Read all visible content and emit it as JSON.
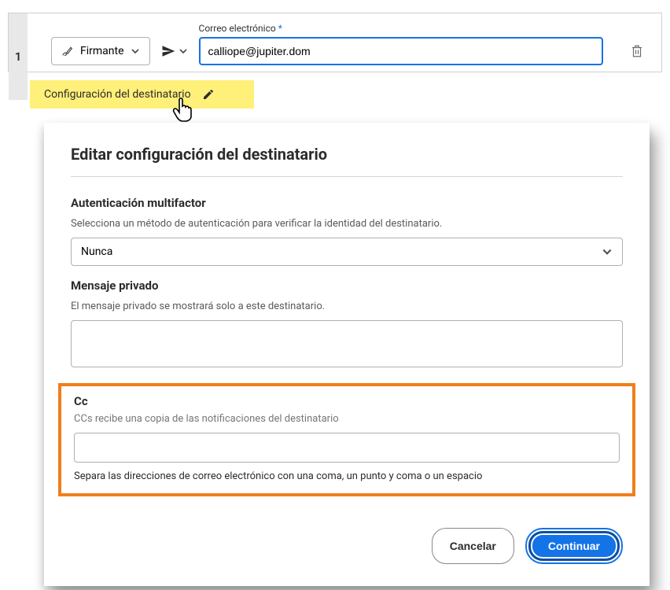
{
  "recipient": {
    "number": "1",
    "role_label": "Firmante",
    "email_label": "Correo electrónico",
    "email_value": "calliope@jupiter.dom",
    "config_label": "Configuración del destinatario"
  },
  "modal": {
    "title": "Editar configuración del destinatario",
    "auth": {
      "heading": "Autenticación multifactor",
      "description": "Selecciona un método de autenticación para verificar la identidad del destinatario.",
      "selected": "Nunca"
    },
    "private_message": {
      "heading": "Mensaje privado",
      "description": "El mensaje privado se mostrará solo a este destinatario.",
      "value": ""
    },
    "cc": {
      "heading": "Cc",
      "description": "CCs recibe una copia de las notificaciones del destinatario",
      "value": "",
      "hint": "Separa las direcciones de correo electrónico con una coma, un punto y coma o un espacio"
    },
    "buttons": {
      "cancel": "Cancelar",
      "continue": "Continuar"
    }
  }
}
